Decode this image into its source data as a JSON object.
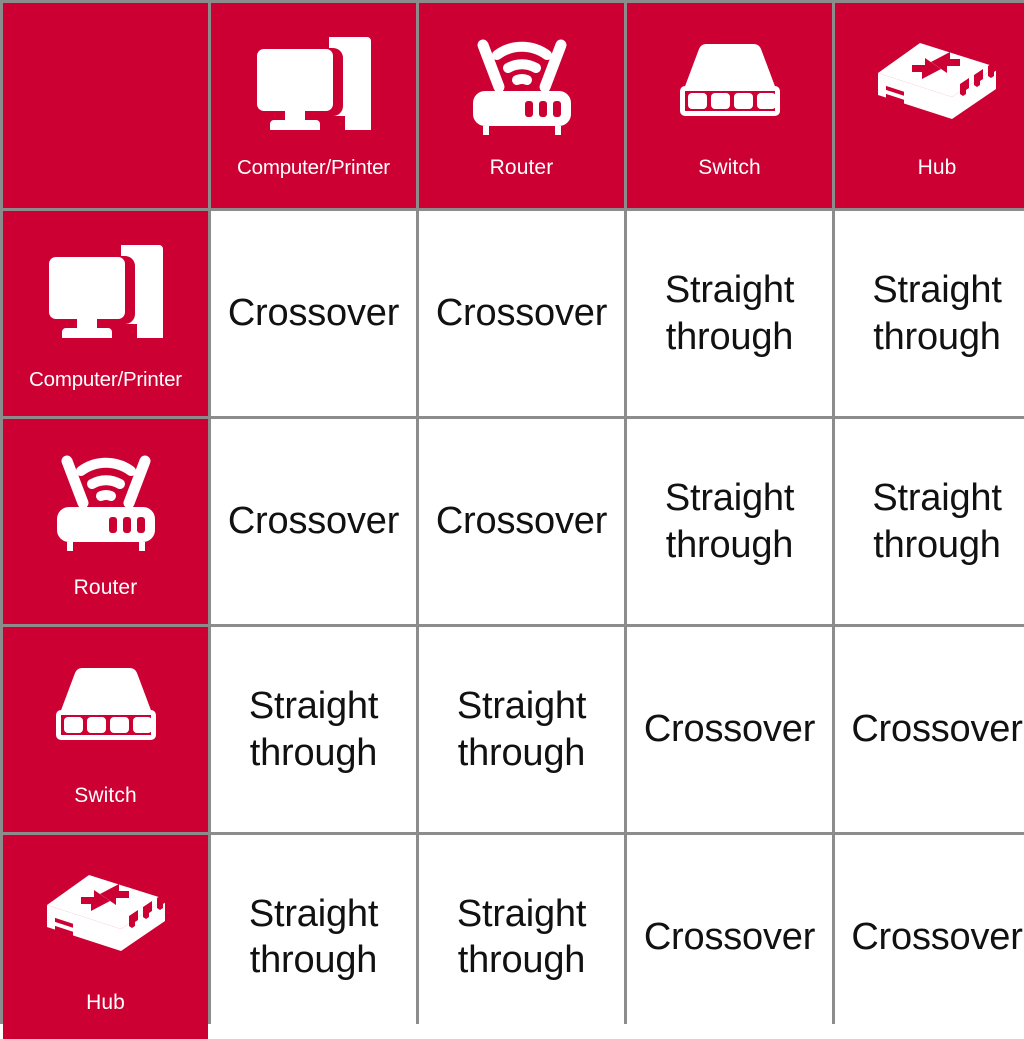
{
  "title": "Ethernet cable type selection matrix",
  "colors": {
    "header_bg": "#cc0033",
    "grid_line": "#8c8c8c",
    "cell_bg": "#ffffff",
    "header_text": "#ffffff",
    "cell_text": "#111111"
  },
  "corner": {
    "label": ""
  },
  "devices": [
    {
      "key": "computer",
      "label": "Computer/Printer",
      "icon": "computer-printer-icon"
    },
    {
      "key": "router",
      "label": "Router",
      "icon": "router-icon"
    },
    {
      "key": "switch",
      "label": "Switch",
      "icon": "switch-icon"
    },
    {
      "key": "hub",
      "label": "Hub",
      "icon": "hub-icon"
    }
  ],
  "column_headers": [
    {
      "label": "Computer/Printer",
      "icon": "computer-printer-icon"
    },
    {
      "label": "Router",
      "icon": "router-icon"
    },
    {
      "label": "Switch",
      "icon": "switch-icon"
    },
    {
      "label": "Hub",
      "icon": "hub-icon"
    }
  ],
  "row_headers": [
    {
      "label": "Computer/Printer",
      "icon": "computer-printer-icon"
    },
    {
      "label": "Router",
      "icon": "router-icon"
    },
    {
      "label": "Switch",
      "icon": "switch-icon"
    },
    {
      "label": "Hub",
      "icon": "hub-icon"
    }
  ],
  "cable_types": {
    "crossover": "Crossover",
    "straight": "Straight\nthrough"
  },
  "matrix": [
    {
      "row": "Computer/Printer",
      "cells": [
        "Crossover",
        "Crossover",
        "Straight\nthrough",
        "Straight\nthrough"
      ]
    },
    {
      "row": "Router",
      "cells": [
        "Crossover",
        "Crossover",
        "Straight\nthrough",
        "Straight\nthrough"
      ]
    },
    {
      "row": "Switch",
      "cells": [
        "Straight\nthrough",
        "Straight\nthrough",
        "Crossover",
        "Crossover"
      ]
    },
    {
      "row": "Hub",
      "cells": [
        "Straight\nthrough",
        "Straight\nthrough",
        "Crossover",
        "Crossover"
      ]
    }
  ]
}
